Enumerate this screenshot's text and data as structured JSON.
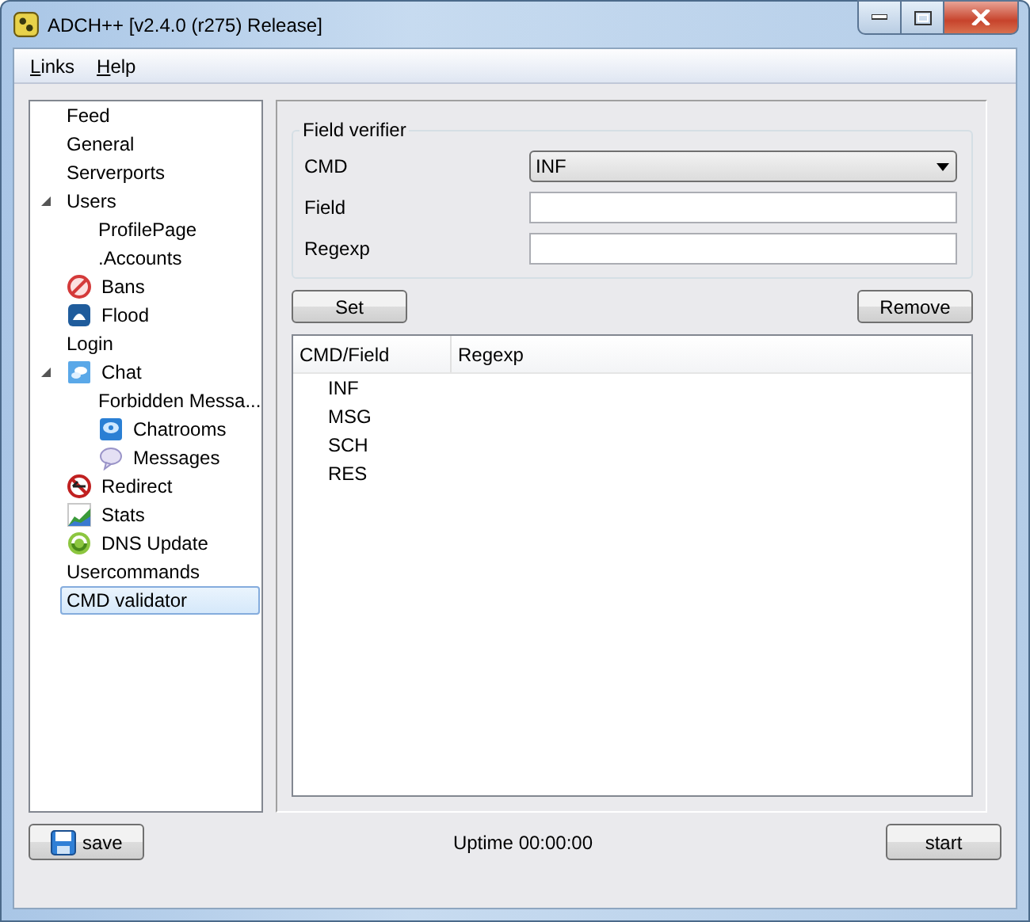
{
  "window": {
    "title": "ADCH++ [v2.4.0 (r275) Release]"
  },
  "menu": [
    "Links",
    "Help"
  ],
  "tree": [
    {
      "label": "Feed",
      "kind": "none",
      "selected": false
    },
    {
      "label": "General",
      "kind": "none",
      "selected": false
    },
    {
      "label": "Serverports",
      "kind": "none",
      "selected": false
    },
    {
      "label": "Users",
      "kind": "none",
      "selected": false,
      "expanded": true,
      "children": [
        {
          "label": "ProfilePage",
          "kind": "none",
          "selected": false
        },
        {
          "label": ".Accounts",
          "kind": "none",
          "selected": false
        }
      ]
    },
    {
      "label": "Bans",
      "kind": "ban",
      "selected": false
    },
    {
      "label": "Flood",
      "kind": "flood",
      "selected": false
    },
    {
      "label": "Login",
      "kind": "none",
      "selected": false
    },
    {
      "label": "Chat",
      "kind": "chat",
      "selected": false,
      "expanded": true,
      "children": [
        {
          "label": "Forbidden Messa...",
          "kind": "none",
          "selected": false
        },
        {
          "label": "Chatrooms",
          "kind": "chatrooms",
          "selected": false
        },
        {
          "label": "Messages",
          "kind": "messages",
          "selected": false
        }
      ]
    },
    {
      "label": "Redirect",
      "kind": "redirect",
      "selected": false
    },
    {
      "label": "Stats",
      "kind": "stats",
      "selected": false
    },
    {
      "label": "DNS Update",
      "kind": "dns",
      "selected": false
    },
    {
      "label": "Usercommands",
      "kind": "none",
      "selected": false
    },
    {
      "label": "CMD validator",
      "kind": "none",
      "selected": true
    }
  ],
  "field_verifier": {
    "title": "Field verifier",
    "cmd": {
      "label": "CMD",
      "value": "INF"
    },
    "field": {
      "label": "Field"
    },
    "regexp": {
      "label": "Regexp"
    }
  },
  "buttons": {
    "set": "Set",
    "remove": "Remove"
  },
  "table": {
    "columns": [
      "CMD/Field",
      "Regexp"
    ],
    "rows": [
      [
        "INF"
      ],
      [
        "MSG"
      ],
      [
        "SCH"
      ],
      [
        "RES"
      ]
    ]
  },
  "footer": {
    "save": "save",
    "status": "Uptime 00:00:00",
    "start": "start"
  }
}
